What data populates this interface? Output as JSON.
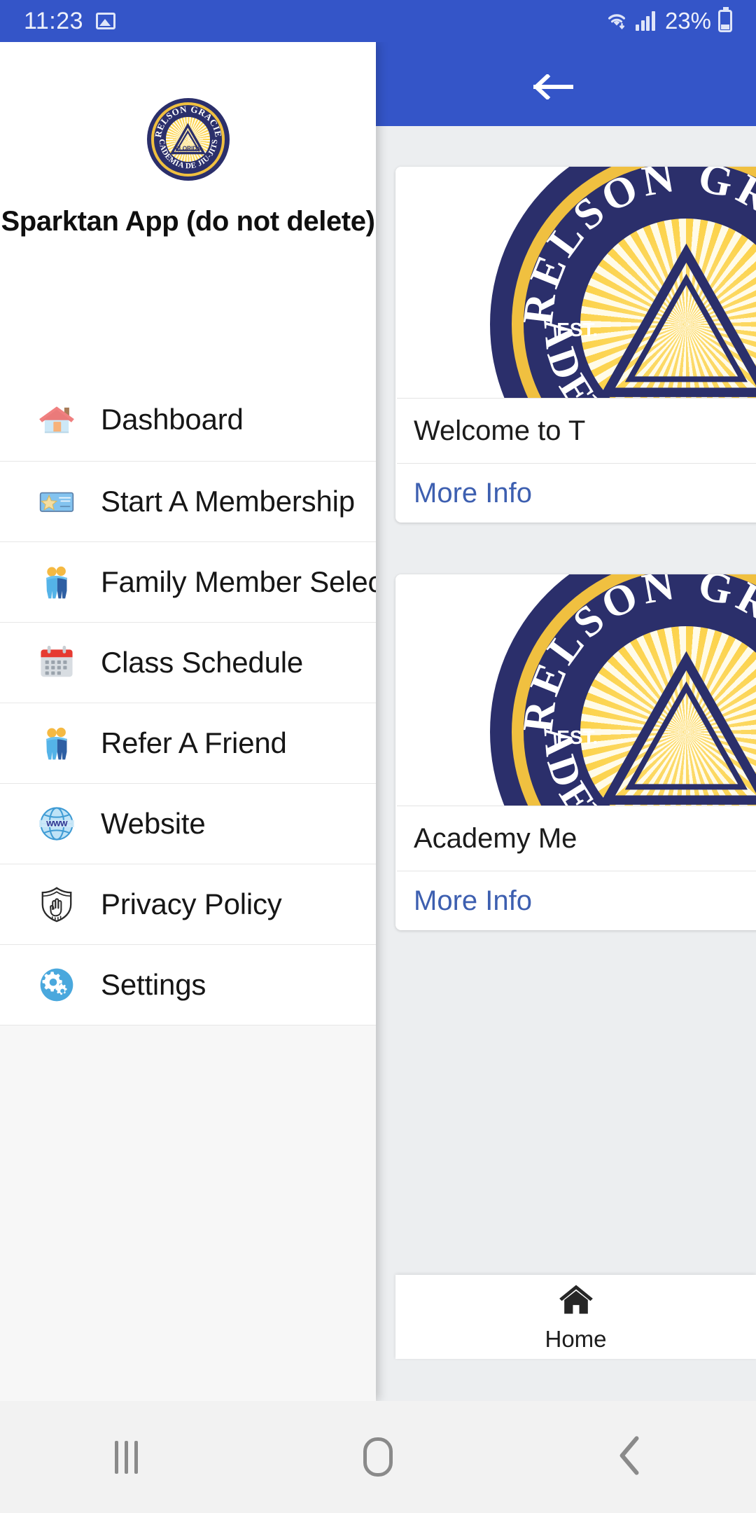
{
  "status_bar": {
    "time": "11:23",
    "battery_percent": "23%",
    "icons": [
      "image-icon",
      "wifi-icon",
      "cellular-signal-icon",
      "battery-icon"
    ]
  },
  "app_bar": {
    "back_label": "Back",
    "back_icon": "arrow-left-icon"
  },
  "theme": {
    "primary": "#3455c8",
    "link": "#3d5fb0",
    "card_background": "#ffffff",
    "page_background": "#eceef0",
    "drawer_background": "#f7f7f7"
  },
  "drawer": {
    "logo_alt": "Relson Gracie Academia de Jiu-Jitsu Florida badge",
    "app_title": "Sparktan App (do not delete)",
    "items": [
      {
        "label": "Dashboard",
        "icon": "house-icon"
      },
      {
        "label": "Start A Membership",
        "icon": "membership-card-icon"
      },
      {
        "label": "Family Member Selection",
        "icon": "two-people-icon"
      },
      {
        "label": "Class Schedule",
        "icon": "calendar-icon"
      },
      {
        "label": "Refer A Friend",
        "icon": "two-people-icon"
      },
      {
        "label": "Website",
        "icon": "www-globe-icon"
      },
      {
        "label": "Privacy Policy",
        "icon": "shield-hand-icon"
      },
      {
        "label": "Settings",
        "icon": "gears-icon"
      }
    ]
  },
  "main": {
    "cards": [
      {
        "title": "Welcome to T",
        "action_label": "More Info",
        "image_alt": "Relson Gracie Academy logo"
      },
      {
        "title": "Academy Me",
        "action_label": "More Info",
        "image_alt": "Relson Gracie Academy logo"
      }
    ]
  },
  "bottom_nav": {
    "items": [
      {
        "label": "Home",
        "icon": "home-icon",
        "selected": true
      }
    ]
  },
  "system_nav": {
    "recents_label": "Recents",
    "home_label": "Home",
    "back_label": "Back"
  }
}
